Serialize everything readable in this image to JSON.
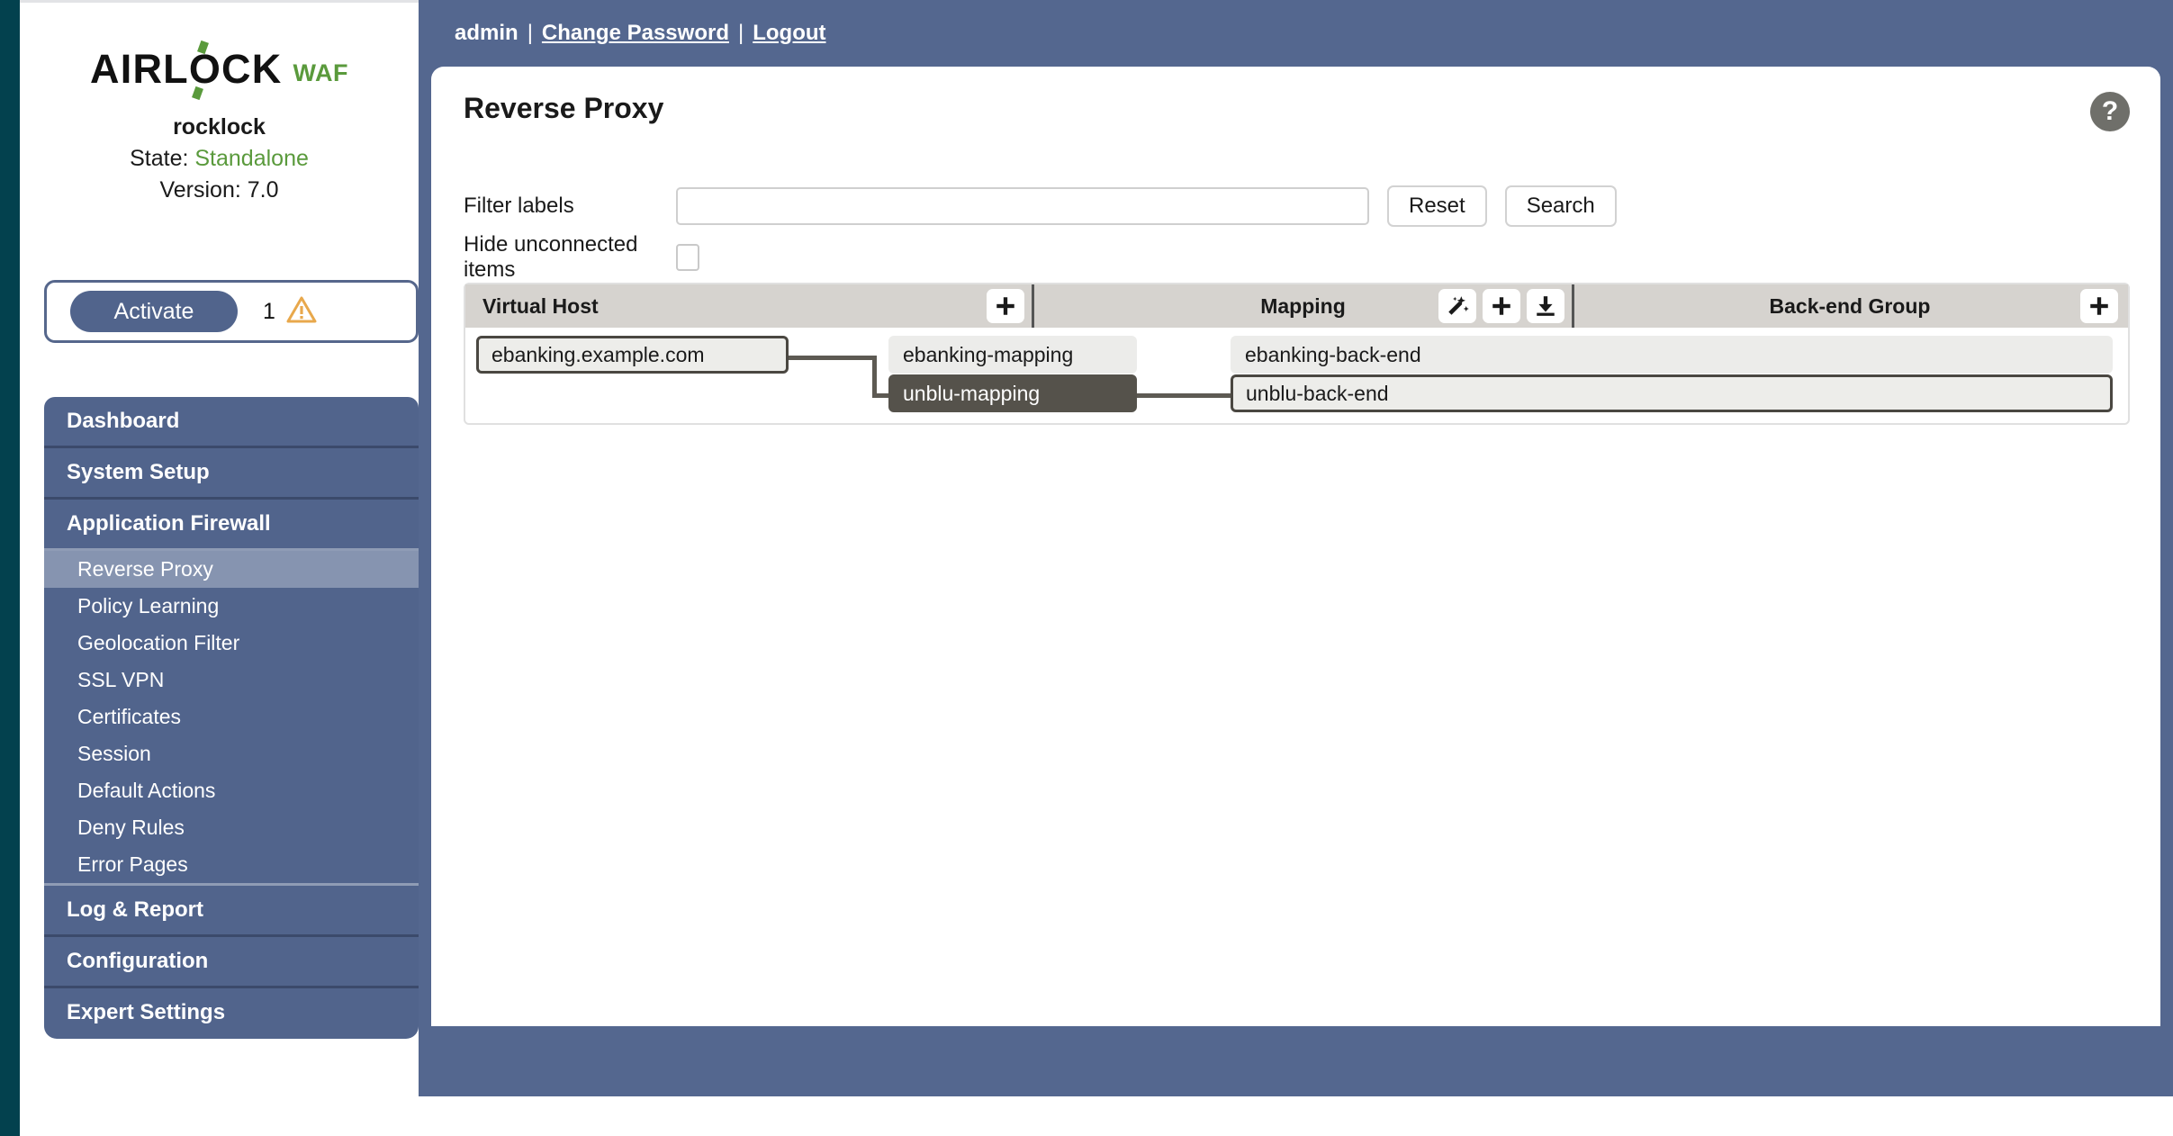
{
  "brand": {
    "logo_primary": "AIRLOCK",
    "logo_suffix": "WAF"
  },
  "appliance": {
    "host_name": "rocklock",
    "state_label": "State:",
    "state_value": "Standalone",
    "version_label": "Version:",
    "version_value": "7.0"
  },
  "activate": {
    "button_label": "Activate",
    "warning_count": "1",
    "warning_icon": "warning-triangle-icon"
  },
  "nav": {
    "dashboard": "Dashboard",
    "system_setup": "System Setup",
    "application_firewall": "Application Firewall",
    "sub_items": [
      "Reverse Proxy",
      "Policy Learning",
      "Geolocation Filter",
      "SSL VPN",
      "Certificates",
      "Session",
      "Default Actions",
      "Deny Rules",
      "Error Pages"
    ],
    "active_sub": "Reverse Proxy",
    "log_report": "Log & Report",
    "configuration": "Configuration",
    "expert_settings": "Expert Settings"
  },
  "topbar": {
    "user": "admin",
    "separator": "|",
    "change_password": "Change Password",
    "logout": "Logout"
  },
  "page": {
    "title": "Reverse Proxy",
    "help_glyph": "?"
  },
  "filters": {
    "labels_label": "Filter labels",
    "labels_value": "",
    "labels_placeholder": "",
    "reset_label": "Reset",
    "search_label": "Search",
    "hide_unconnected_label": "Hide unconnected items",
    "hide_unconnected_checked": false
  },
  "table": {
    "columns": [
      {
        "title": "Virtual Host",
        "actions": [
          "plus-icon"
        ]
      },
      {
        "title": "Mapping",
        "actions": [
          "magic-wand-icon",
          "plus-icon",
          "download-icon"
        ]
      },
      {
        "title": "Back-end Group",
        "actions": [
          "plus-icon"
        ]
      }
    ],
    "virtual_hosts": [
      {
        "label": "ebanking.example.com",
        "state": "outlined"
      }
    ],
    "mappings": [
      {
        "label": "ebanking-mapping",
        "state": "normal"
      },
      {
        "label": "unblu-mapping",
        "state": "selected"
      }
    ],
    "backend_groups": [
      {
        "label": "ebanking-back-end",
        "state": "normal"
      },
      {
        "label": "unblu-back-end",
        "state": "outlined"
      }
    ]
  },
  "colors": {
    "sidebar_blue": "#51648c",
    "panel_blue": "#54678f",
    "edge_teal": "#03414e",
    "accent_green": "#5a9a3c",
    "warning_amber": "#e8a84c",
    "selection_dark": "#55524b",
    "table_header": "#d6d3cf"
  }
}
